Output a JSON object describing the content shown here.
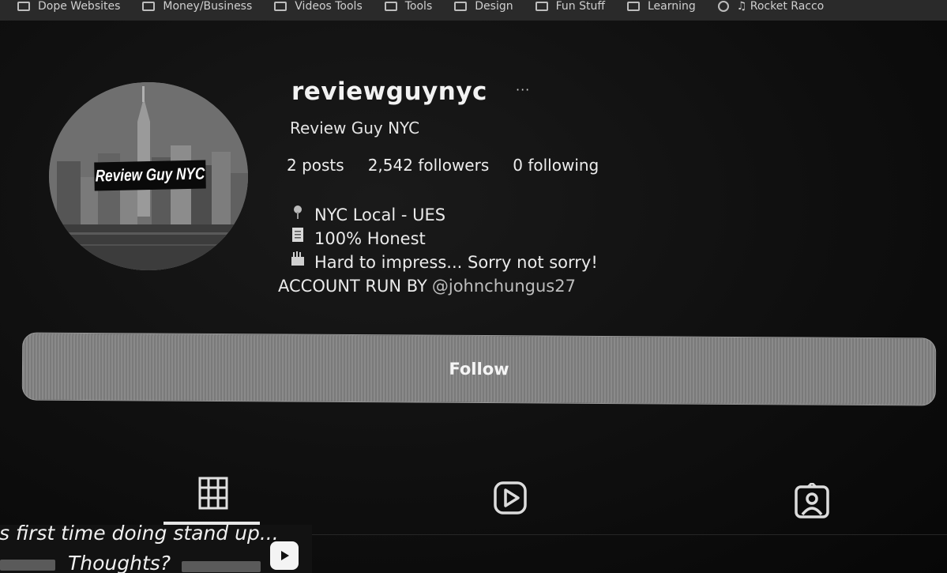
{
  "bookmarks": [
    {
      "label": "Dope Websites"
    },
    {
      "label": "Money/Business"
    },
    {
      "label": "Videos Tools"
    },
    {
      "label": "Tools"
    },
    {
      "label": "Design"
    },
    {
      "label": "Fun Stuff"
    },
    {
      "label": "Learning"
    },
    {
      "label": "♫ Rocket Racco"
    }
  ],
  "profile": {
    "avatar_text": "Review Guy NYC",
    "username": "reviewguynyc",
    "more_label": "···",
    "full_name": "Review Guy NYC",
    "stats": {
      "posts": "2 posts",
      "followers": "2,542 followers",
      "following": "0 following"
    },
    "bio": {
      "line1_icon": "pin-icon",
      "line1": "NYC Local - UES",
      "line2_icon": "document-icon",
      "line2": "100% Honest",
      "line3_icon": "clapper-icon",
      "line3": "Hard to impress... Sorry not sorry!",
      "line4_prefix": "ACCOUNT RUN BY",
      "line4_mention": "@johnchungus27"
    },
    "follow_label": "Follow"
  },
  "tabs": [
    {
      "name": "posts",
      "icon": "grid-icon",
      "active": true
    },
    {
      "name": "reels",
      "icon": "play-square-icon",
      "active": false
    },
    {
      "name": "tagged",
      "icon": "tagged-user-icon",
      "active": false
    }
  ],
  "post": {
    "line1": "is first time doing stand up...",
    "line2": "Thoughts?",
    "badge_icon": "play-icon"
  },
  "colors": {
    "background": "#0b0b0b",
    "follow_button": "#858585",
    "text": "#eaeaea"
  }
}
